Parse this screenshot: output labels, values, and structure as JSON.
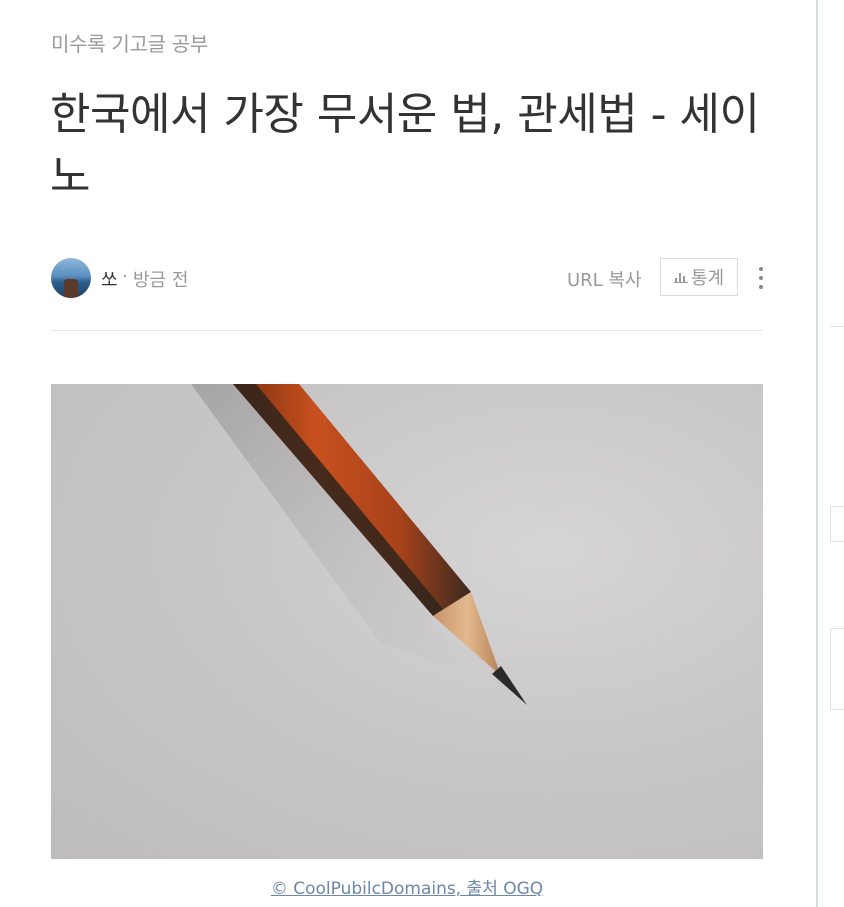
{
  "post": {
    "category": "미수록 기고글 공부",
    "title": "한국에서 가장 무서운 법, 관세법 - 세이노",
    "author": "쏘",
    "separator": "·",
    "time": "방금 전",
    "url_copy_label": "URL 복사",
    "stats_label": "통계",
    "more_icon": "more-vertical-icon",
    "stats_icon": "bar-chart-icon"
  },
  "image": {
    "alt": "",
    "caption": "© CoolPubilcDomains, 출처 OGQ"
  },
  "colors": {
    "title": "#333333",
    "muted": "#999999",
    "caption_link": "#6d87a8",
    "pencil_body": "#c8501e"
  }
}
